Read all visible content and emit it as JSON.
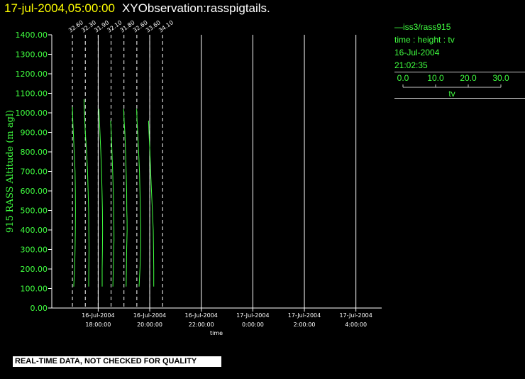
{
  "header": {
    "date": "17-jul-2004,05:00:00",
    "title": "XYObservation:rasspigtails."
  },
  "legend": {
    "series_label": "iss3/rass915",
    "variables": "time : height : tv",
    "date": "16-Jul-2004",
    "time": "21:02:35",
    "scale_ticks": [
      "0.0",
      "10.0",
      "20.0",
      "30.0"
    ],
    "scale_label": "tv"
  },
  "footer": {
    "note": "REAL-TIME DATA, NOT CHECKED FOR QUALITY"
  },
  "colors": {
    "background": "#000000",
    "series": "#40ff40",
    "axis_text": "#40ff40",
    "axis_lines": "#ffffff",
    "title_date": "#ffff00",
    "title_text": "#ffffff"
  },
  "chart_data": {
    "type": "line",
    "title": "XYObservation:rasspigtails.",
    "xlabel": "time",
    "ylabel": "915 RASS Altitude (m agl)",
    "ylim": [
      0,
      1400
    ],
    "yticks": [
      "0.00",
      "100.00",
      "200.00",
      "300.00",
      "400.00",
      "500.00",
      "600.00",
      "700.00",
      "800.00",
      "900.00",
      "1000.00",
      "1100.00",
      "1200.00",
      "1300.00",
      "1400.00"
    ],
    "x_time_range": [
      "16-Jul-2004 16:12",
      "17-Jul-2004 05:00"
    ],
    "xticks": [
      {
        "date": "16-Jul-2004",
        "time": "18:00:00"
      },
      {
        "date": "16-Jul-2004",
        "time": "20:00:00"
      },
      {
        "date": "16-Jul-2004",
        "time": "22:00:00"
      },
      {
        "date": "17-Jul-2004",
        "time": "0:00:00"
      },
      {
        "date": "17-Jul-2004",
        "time": "2:00:00"
      },
      {
        "date": "17-Jul-2004",
        "time": "4:00:00"
      }
    ],
    "grid": true,
    "profiles": [
      {
        "base_time": "16-Jul-2004 17:00",
        "label": "32.60",
        "points": [
          [
            0,
            1030
          ],
          [
            0.5,
            950
          ],
          [
            1.2,
            880
          ],
          [
            2.0,
            800
          ],
          [
            3.0,
            700
          ],
          [
            3.3,
            600
          ],
          [
            3.5,
            500
          ],
          [
            3.3,
            400
          ],
          [
            3.0,
            300
          ],
          [
            2.5,
            200
          ],
          [
            1.5,
            110
          ]
        ]
      },
      {
        "base_time": "16-Jul-2004 17:30",
        "label": "32.30",
        "points": [
          [
            -1.5,
            1070
          ],
          [
            -1.0,
            1000
          ],
          [
            0,
            900
          ],
          [
            1.5,
            800
          ],
          [
            2.5,
            700
          ],
          [
            3.2,
            600
          ],
          [
            3.8,
            500
          ],
          [
            4.0,
            400
          ],
          [
            4.2,
            300
          ],
          [
            4.0,
            200
          ],
          [
            3.8,
            110
          ]
        ]
      },
      {
        "base_time": "16-Jul-2004 18:00",
        "label": "31.90",
        "points": [
          [
            0.8,
            1020
          ],
          [
            1.5,
            950
          ],
          [
            2.0,
            900
          ],
          [
            3.0,
            800
          ],
          [
            3.8,
            700
          ],
          [
            4.3,
            600
          ],
          [
            4.8,
            500
          ],
          [
            5.0,
            400
          ],
          [
            4.8,
            300
          ],
          [
            4.5,
            200
          ],
          [
            4.5,
            110
          ]
        ]
      },
      {
        "base_time": "16-Jul-2004 18:30",
        "label": "32.10",
        "points": [
          [
            -0.5,
            960
          ],
          [
            0.2,
            900
          ],
          [
            1.0,
            800
          ],
          [
            1.8,
            700
          ],
          [
            2.5,
            600
          ],
          [
            3.0,
            500
          ],
          [
            3.2,
            400
          ],
          [
            3.3,
            350
          ],
          [
            3.0,
            300
          ],
          [
            2.5,
            200
          ],
          [
            2.0,
            110
          ]
        ]
      },
      {
        "base_time": "16-Jul-2004 19:00",
        "label": "31.80",
        "points": [
          [
            -0.3,
            1020
          ],
          [
            0.3,
            950
          ],
          [
            1.0,
            900
          ],
          [
            1.8,
            800
          ],
          [
            2.5,
            700
          ],
          [
            3.0,
            600
          ],
          [
            3.2,
            500
          ],
          [
            3.5,
            450
          ],
          [
            3.6,
            400
          ],
          [
            3.0,
            300
          ],
          [
            2.8,
            200
          ],
          [
            2.5,
            110
          ]
        ]
      },
      {
        "base_time": "16-Jul-2004 19:30",
        "label": "32.60",
        "points": [
          [
            -0.2,
            1020
          ],
          [
            0.3,
            950
          ],
          [
            1.0,
            900
          ],
          [
            2.0,
            800
          ],
          [
            3.0,
            700
          ],
          [
            3.5,
            600
          ],
          [
            4.0,
            500
          ],
          [
            4.5,
            400
          ],
          [
            4.3,
            300
          ],
          [
            3.5,
            200
          ],
          [
            2.5,
            110
          ]
        ]
      },
      {
        "base_time": "16-Jul-2004 20:00",
        "label": "33.60",
        "points": [
          [
            -1.3,
            960
          ],
          [
            -0.8,
            900
          ],
          [
            0.2,
            800
          ],
          [
            1.0,
            700
          ],
          [
            2.0,
            600
          ],
          [
            3.0,
            500
          ],
          [
            4.0,
            400
          ],
          [
            4.3,
            300
          ],
          [
            4.5,
            200
          ],
          [
            4.5,
            110
          ]
        ]
      },
      {
        "base_time": "16-Jul-2004 20:30",
        "label": "34.10",
        "points": []
      }
    ]
  }
}
